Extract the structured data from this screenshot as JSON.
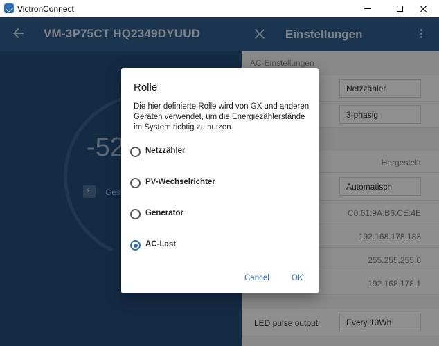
{
  "window": {
    "title": "VictronConnect"
  },
  "left": {
    "device_title": "VM-3P75CT HQ2349DYUUD",
    "power_value": "-52",
    "summary_label": "Ges"
  },
  "right": {
    "title": "Einstellungen",
    "section_ac": "AC-Einstellungen",
    "rows": [
      {
        "value": "Netzzähler",
        "kind": "box"
      },
      {
        "value": "3-phasig",
        "kind": "box"
      },
      {
        "value": "Hergestellt",
        "kind": "text"
      },
      {
        "value": "Automatisch",
        "kind": "box"
      },
      {
        "value": "C0:61:9A:B6:CE:4E",
        "kind": "text"
      },
      {
        "value": "192.168.178.183",
        "kind": "text"
      },
      {
        "value": "255.255.255.0",
        "kind": "text"
      },
      {
        "value": "192.168.178.1",
        "kind": "text"
      }
    ],
    "led_label": "LED pulse output",
    "led_value": "Every 10Wh"
  },
  "dialog": {
    "title": "Rolle",
    "description": "Die hier definierte Rolle wird von GX und anderen Geräten verwendet, um die Energiezählerstände im System richtig zu nutzen.",
    "options": [
      {
        "label": "Netzzähler",
        "selected": false
      },
      {
        "label": "PV-Wechselrichter",
        "selected": false
      },
      {
        "label": "Generator",
        "selected": false
      },
      {
        "label": "AC-Last",
        "selected": true
      }
    ],
    "cancel_label": "Cancel",
    "ok_label": "OK"
  },
  "colors": {
    "accent": "#2f6db4",
    "appbar": "#2f5a8a",
    "left_bg": "#244a75"
  }
}
